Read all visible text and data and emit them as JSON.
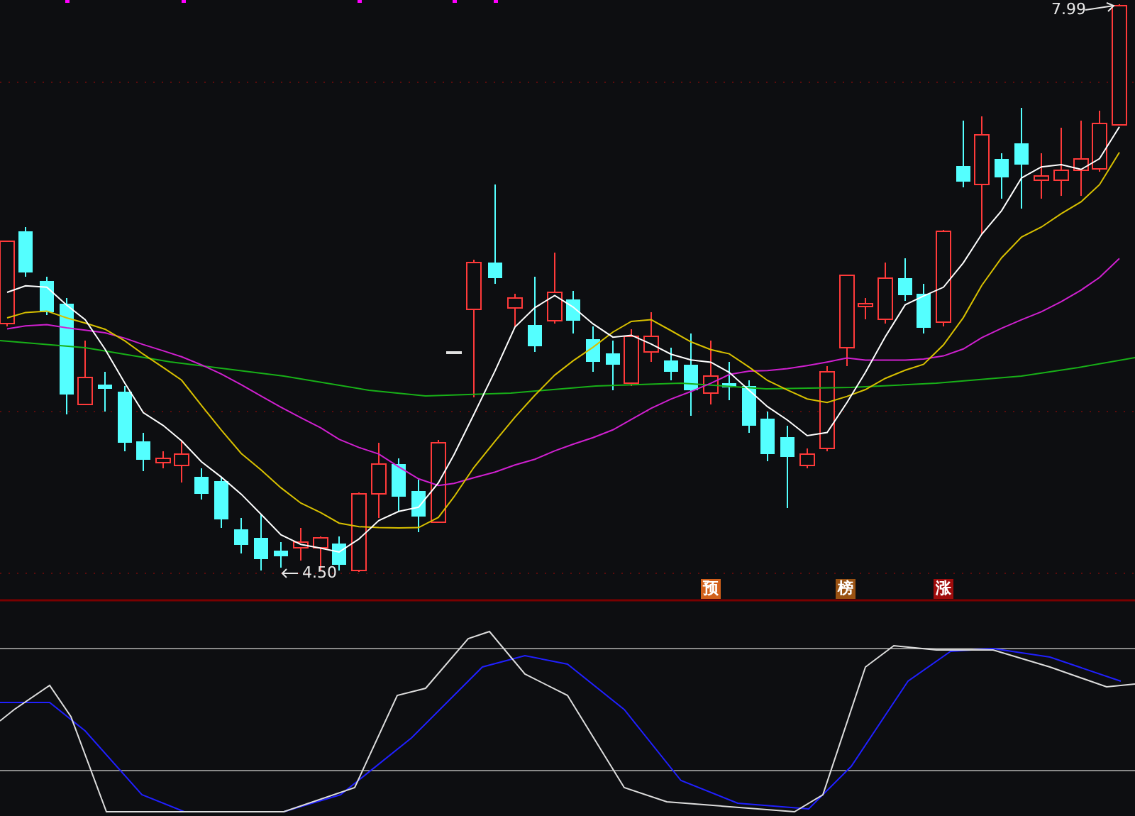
{
  "price_labels": {
    "high": "7.99",
    "low": "4.50"
  },
  "signals": [
    {
      "label": "预",
      "color": "#d2601a"
    },
    {
      "label": "榜",
      "color": "#9a5212"
    },
    {
      "label": "涨",
      "color": "#a00c0c"
    }
  ]
}
